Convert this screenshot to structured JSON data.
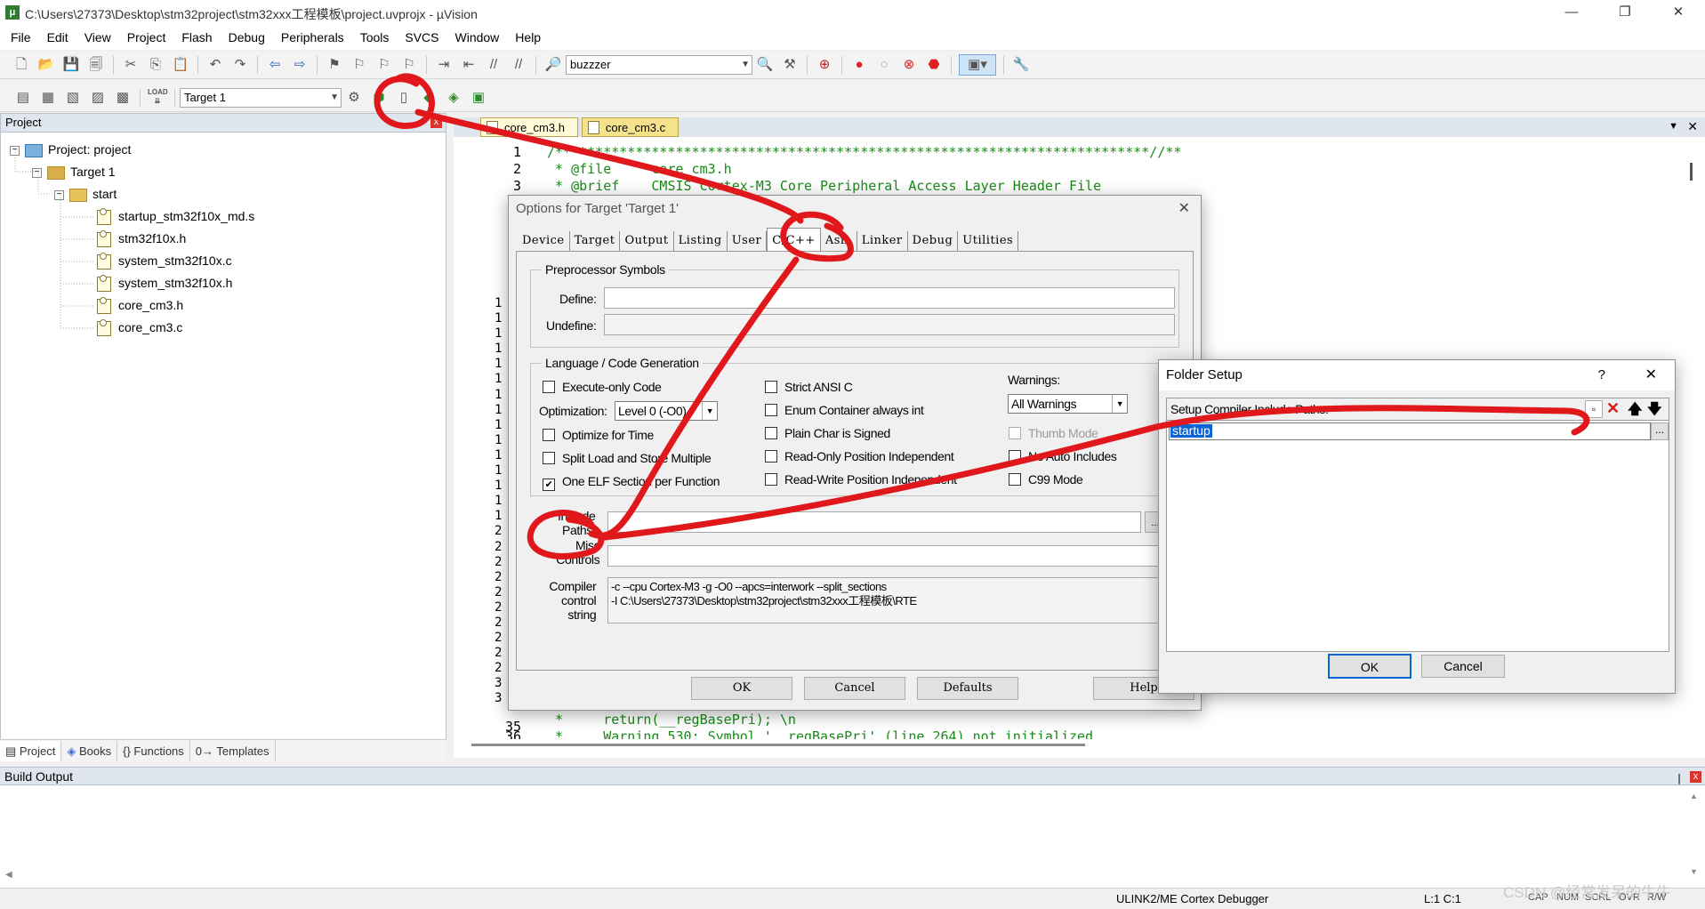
{
  "window": {
    "title": "C:\\Users\\27373\\Desktop\\stm32project\\stm32xxx工程模板\\project.uvprojx - µVision",
    "icon": "μ",
    "controls": [
      "—",
      "❐",
      "✕"
    ]
  },
  "menu": [
    "File",
    "Edit",
    "View",
    "Project",
    "Flash",
    "Debug",
    "Peripherals",
    "Tools",
    "SVCS",
    "Window",
    "Help"
  ],
  "toolbar1": {
    "find_combo": "buzzzer"
  },
  "toolbar2": {
    "target_combo": "Target 1",
    "load_icon_text": "LOAD"
  },
  "project_panel": {
    "title": "Project",
    "close": "x",
    "tree": {
      "root": "Project: project",
      "target": "Target 1",
      "group": "start",
      "files": [
        "startup_stm32f10x_md.s",
        "stm32f10x.h",
        "system_stm32f10x.c",
        "system_stm32f10x.h",
        "core_cm3.h",
        "core_cm3.c"
      ]
    },
    "tabs": [
      "Project",
      "Books",
      "{} Functions",
      "0→ Templates"
    ]
  },
  "editor": {
    "tabs": [
      "core_cm3.h",
      "core_cm3.c"
    ],
    "controls": [
      "▼",
      "✕"
    ],
    "line_numbers_top": [
      "1",
      "2",
      "3"
    ],
    "code_top": [
      "/**************************************************************************//**",
      " * @file     core_cm3.h",
      " * @brief    CMSIS Cortex-M3 Core Peripheral Access Layer Header File"
    ],
    "hidden_ln_marks": [
      "1",
      "1",
      "1",
      "1",
      "1",
      "1",
      "1",
      "1",
      "1",
      "1",
      "1",
      "1",
      "1",
      "1",
      "1",
      "2",
      "2",
      "2",
      "2",
      "2",
      "2",
      "2",
      "2",
      "2",
      "2",
      "3",
      "3"
    ],
    "line_numbers_bottom": [
      "35",
      "36"
    ],
    "code_bottom": [
      " *     return(__regBasePri); \\n",
      " *     Warning 530: Symbol '__regBasePri' (line 264) not initialized"
    ]
  },
  "options_dialog": {
    "title": "Options for Target 'Target 1'",
    "close": "✕",
    "tabs": [
      "Device",
      "Target",
      "Output",
      "Listing",
      "User",
      "C/C++",
      "Asm",
      "Linker",
      "Debug",
      "Utilities"
    ],
    "active_tab": "C/C++",
    "preprocessor": {
      "legend": "Preprocessor Symbols",
      "define_label": "Define:",
      "define_value": "",
      "undefine_label": "Undefine:",
      "undefine_value": ""
    },
    "language": {
      "legend": "Language / Code Generation",
      "execute_only": "Execute-only Code",
      "optimization_label": "Optimization:",
      "optimization_value": "Level 0 (-O0)",
      "optimize_time": "Optimize for Time",
      "split_load": "Split Load and Store Multiple",
      "one_elf": "One ELF Section per Function",
      "strict_ansi": "Strict ANSI C",
      "enum_container": "Enum Container always int",
      "plain_char": "Plain Char is Signed",
      "ro_pi": "Read-Only Position Independent",
      "rw_pi": "Read-Write Position Independent",
      "warnings_label": "Warnings:",
      "warnings_value": "All Warnings",
      "thumb_mode": "Thumb Mode",
      "no_auto_includes": "No Auto Includes",
      "c99_mode": "C99 Mode"
    },
    "include_paths_label_1": "Include",
    "include_paths_label_2": "Paths",
    "include_paths_value": "",
    "browse": "...",
    "misc_label_1": "Misc",
    "misc_label_2": "Controls",
    "misc_value": "",
    "compiler_label_1": "Compiler",
    "compiler_label_2": "control",
    "compiler_label_3": "string",
    "compiler_string_1": "-c --cpu Cortex-M3 -g -O0 --apcs=interwork --split_sections",
    "compiler_string_2": "-I C:\\Users\\27373\\Desktop\\stm32project\\stm32xxx工程模板\\RTE",
    "buttons": {
      "ok": "OK",
      "cancel": "Cancel",
      "defaults": "Defaults",
      "help": "Help"
    }
  },
  "folder_dialog": {
    "title": "Folder Setup",
    "help": "?",
    "close": "✕",
    "header": "Setup Compiler Include Paths:",
    "entry": "startup",
    "browse": "...",
    "buttons": {
      "ok": "OK",
      "cancel": "Cancel"
    }
  },
  "build_output": {
    "title": "Build Output",
    "pin": "❘",
    "close": "x"
  },
  "status": {
    "debugger": "ULINK2/ME Cortex Debugger",
    "position": "L:1 C:1",
    "caps": "CAP",
    "num": "NUM",
    "scrl": "SCRL",
    "ovr": "OVR",
    "rw": "R/W"
  },
  "watermark": "CSDN @经常发呆的牛牛",
  "colors": {
    "annotation": "#e0181b",
    "tab_bg": "#f5e28b",
    "panel_header": "#dfe6ee"
  }
}
